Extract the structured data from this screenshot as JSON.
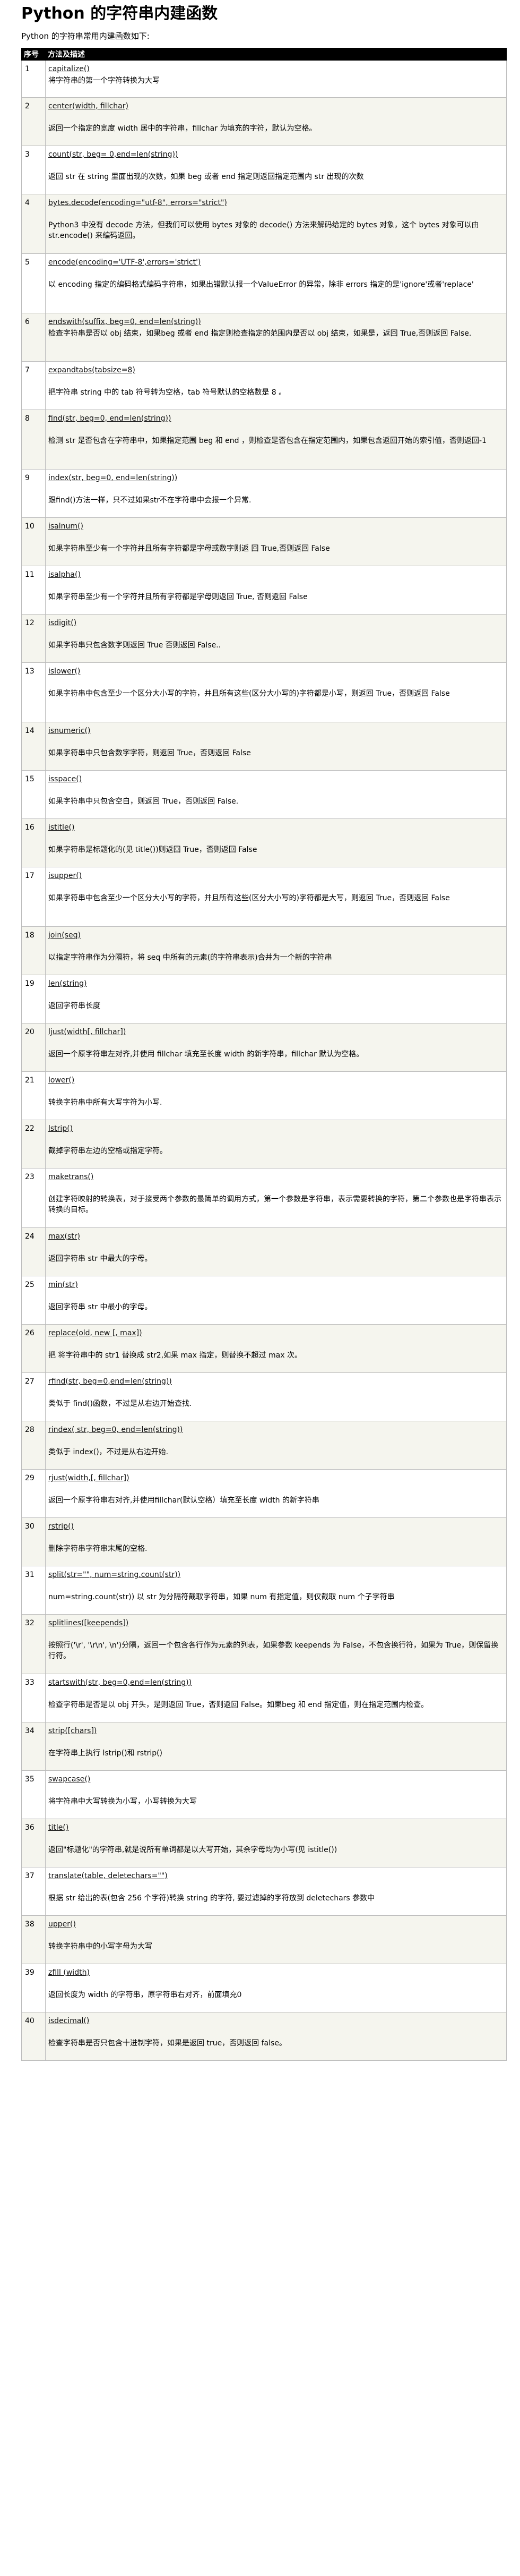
{
  "title": "Python 的字符串内建函数",
  "intro": "Python 的字符串常用内建函数如下:",
  "headers": {
    "num": "序号",
    "desc": "方法及描述"
  },
  "rows": [
    {
      "num": "1",
      "sig": "capitalize()",
      "desc": "将字符串的第一个字符转换为大写",
      "gap": false,
      "h": "r3"
    },
    {
      "num": "2",
      "sig": "center(width, fillchar)",
      "desc": "返回一个指定的宽度 width 居中的字符串，fillchar 为填充的字符，默认为空格。",
      "gap": true,
      "h": "r4"
    },
    {
      "num": "3",
      "sig": "count(str, beg= 0,end=len(string))",
      "desc": "返回 str 在 string 里面出现的次数，如果 beg 或者 end 指定则返回指定范围内 str 出现的次数",
      "gap": true,
      "h": "r4"
    },
    {
      "num": "4",
      "sig": "bytes.decode(encoding=\"utf-8\", errors=\"strict\")",
      "desc": "Python3 中没有 decode 方法，但我们可以使用 bytes 对象的 decode() 方法来解码给定的 bytes 对象，这个 bytes 对象可以由 str.encode() 来编码返回。",
      "gap": true,
      "h": "r5"
    },
    {
      "num": "5",
      "sig": "encode(encoding='UTF-8',errors='strict')",
      "desc": "以 encoding 指定的编码格式编码字符串，如果出错默认报一个ValueError 的异常，除非 errors 指定的是'ignore'或者'replace'",
      "gap": true,
      "h": "r5"
    },
    {
      "num": "6",
      "sig": "endswith(suffix, beg=0, end=len(string))",
      "desc": "检查字符串是否以 obj 结束，如果beg 或者 end 指定则检查指定的范围内是否以 obj 结束，如果是，返回 True,否则返回 False.",
      "gap": false,
      "h": "r4"
    },
    {
      "num": "7",
      "sig": "expandtabs(tabsize=8)",
      "desc": "把字符串 string 中的 tab 符号转为空格，tab 符号默认的空格数是 8 。",
      "gap": true,
      "h": "r4"
    },
    {
      "num": "8",
      "sig": "find(str, beg=0, end=len(string))",
      "desc": "检测 str 是否包含在字符串中，如果指定范围 beg 和 end ，则检查是否包含在指定范围内，如果包含返回开始的索引值，否则返回-1",
      "gap": true,
      "h": "r5"
    },
    {
      "num": "9",
      "sig": "index(str, beg=0, end=len(string))",
      "desc": "跟find()方法一样，只不过如果str不在字符串中会报一个异常.",
      "gap": true,
      "h": "r4"
    },
    {
      "num": "10",
      "sig": "isalnum()",
      "desc": "如果字符串至少有一个字符并且所有字符都是字母或数字则返 回 True,否则返回 False",
      "gap": true,
      "h": "r4"
    },
    {
      "num": "11",
      "sig": "isalpha()",
      "desc": "如果字符串至少有一个字符并且所有字符都是字母则返回 True, 否则返回 False",
      "gap": true,
      "h": "r4"
    },
    {
      "num": "12",
      "sig": "isdigit()",
      "desc": "如果字符串只包含数字则返回 True 否则返回 False..",
      "gap": true,
      "h": "r4"
    },
    {
      "num": "13",
      "sig": "islower()",
      "desc": "如果字符串中包含至少一个区分大小写的字符，并且所有这些(区分大小写的)字符都是小写，则返回 True，否则返回 False",
      "gap": true,
      "h": "r5"
    },
    {
      "num": "14",
      "sig": "isnumeric()",
      "desc": "如果字符串中只包含数字字符，则返回 True，否则返回 False",
      "gap": true,
      "h": "r4"
    },
    {
      "num": "15",
      "sig": "isspace()",
      "desc": "如果字符串中只包含空白，则返回 True，否则返回 False.",
      "gap": true,
      "h": "r4"
    },
    {
      "num": "16",
      "sig": "istitle()",
      "desc": "如果字符串是标题化的(见 title())则返回 True，否则返回 False",
      "gap": true,
      "h": "r4"
    },
    {
      "num": "17",
      "sig": "isupper()",
      "desc": "如果字符串中包含至少一个区分大小写的字符，并且所有这些(区分大小写的)字符都是大写，则返回 True，否则返回 False",
      "gap": true,
      "h": "r5"
    },
    {
      "num": "18",
      "sig": "join(seq)",
      "desc": "以指定字符串作为分隔符，将 seq 中所有的元素(的字符串表示)合并为一个新的字符串",
      "gap": true,
      "h": "r4"
    },
    {
      "num": "19",
      "sig": "len(string)",
      "desc": "返回字符串长度",
      "gap": true,
      "h": "r4"
    },
    {
      "num": "20",
      "sig": "ljust(width[, fillchar])",
      "desc": "返回一个原字符串左对齐,并使用 fillchar 填充至长度 width 的新字符串，fillchar 默认为空格。",
      "gap": true,
      "h": "r4"
    },
    {
      "num": "21",
      "sig": "lower()",
      "desc": "转换字符串中所有大写字符为小写.",
      "gap": true,
      "h": "r4"
    },
    {
      "num": "22",
      "sig": "lstrip()",
      "desc": "截掉字符串左边的空格或指定字符。",
      "gap": true,
      "h": "r4"
    },
    {
      "num": "23",
      "sig": "maketrans()",
      "desc": "创建字符映射的转换表，对于接受两个参数的最简单的调用方式，第一个参数是字符串，表示需要转换的字符，第二个参数也是字符串表示转换的目标。",
      "gap": true,
      "h": "r5"
    },
    {
      "num": "24",
      "sig": "max(str)",
      "desc": "返回字符串 str 中最大的字母。",
      "gap": true,
      "h": "r4"
    },
    {
      "num": "25",
      "sig": "min(str)",
      "desc": "返回字符串 str 中最小的字母。",
      "gap": true,
      "h": "r4"
    },
    {
      "num": "26",
      "sig": "replace(old, new [, max])",
      "desc": "把 将字符串中的 str1 替换成 str2,如果 max 指定，则替换不超过 max 次。",
      "gap": true,
      "h": "r4"
    },
    {
      "num": "27",
      "sig": "rfind(str, beg=0,end=len(string))",
      "desc": "类似于 find()函数，不过是从右边开始查找.",
      "gap": true,
      "h": "r4"
    },
    {
      "num": "28",
      "sig": "rindex( str, beg=0, end=len(string))",
      "desc": "类似于 index()，不过是从右边开始.",
      "gap": true,
      "h": "r4"
    },
    {
      "num": "29",
      "sig": "rjust(width,[, fillchar])",
      "desc": "返回一个原字符串右对齐,并使用fillchar(默认空格）填充至长度 width 的新字符串",
      "gap": true,
      "h": "r4"
    },
    {
      "num": "30",
      "sig": "rstrip()",
      "desc": "删除字符串字符串末尾的空格.",
      "gap": true,
      "h": "r4"
    },
    {
      "num": "31",
      "sig": "split(str=\"\", num=string.count(str))",
      "desc": "num=string.count(str)) 以 str 为分隔符截取字符串，如果 num 有指定值，则仅截取 num 个子字符串",
      "gap": true,
      "h": "r4"
    },
    {
      "num": "32",
      "sig": "splitlines([keepends])",
      "desc": "按照行('\\r', '\\r\\n', \\n')分隔，返回一个包含各行作为元素的列表，如果参数 keepends 为 False，不包含换行符，如果为 True，则保留换行符。",
      "gap": true,
      "h": "r5"
    },
    {
      "num": "33",
      "sig": "startswith(str, beg=0,end=len(string))",
      "desc": "检查字符串是否是以 obj 开头，是则返回 True，否则返回 False。如果beg 和 end 指定值，则在指定范围内检查。",
      "gap": true,
      "h": "r4"
    },
    {
      "num": "34",
      "sig": "strip([chars])",
      "desc": "在字符串上执行 lstrip()和 rstrip()",
      "gap": true,
      "h": "r4"
    },
    {
      "num": "35",
      "sig": "swapcase()",
      "desc": "将字符串中大写转换为小写，小写转换为大写",
      "gap": true,
      "h": "r4"
    },
    {
      "num": "36",
      "sig": "title()",
      "desc": "返回\"标题化\"的字符串,就是说所有单词都是以大写开始，其余字母均为小写(见 istitle())",
      "gap": true,
      "h": "r4"
    },
    {
      "num": "37",
      "sig": "translate(table, deletechars=\"\")",
      "desc": "根据 str 给出的表(包含 256 个字符)转换 string 的字符, 要过滤掉的字符放到 deletechars 参数中",
      "gap": true,
      "h": "r4"
    },
    {
      "num": "38",
      "sig": "upper()",
      "desc": "转换字符串中的小写字母为大写",
      "gap": true,
      "h": "r4"
    },
    {
      "num": "39",
      "sig": "zfill (width)",
      "desc": "返回长度为 width 的字符串，原字符串右对齐，前面填充0",
      "gap": true,
      "h": "r4"
    },
    {
      "num": "40",
      "sig": "isdecimal()",
      "desc": "检查字符串是否只包含十进制字符，如果是返回 true，否则返回 false。",
      "gap": true,
      "h": "r4"
    }
  ]
}
